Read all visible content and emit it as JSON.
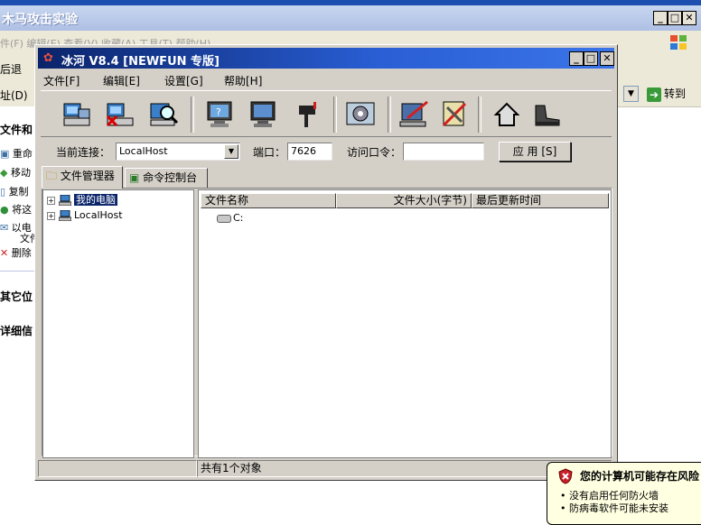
{
  "bg_window": {
    "title": "木马攻击实验",
    "menu_text": "件(F)  编辑(E)  查看(V)  收藏(A)  工具(T)  帮助(H)",
    "back_label": "后退",
    "addr_label": "址(D)",
    "go_label": "转到",
    "tasks": {
      "file_tasks_head": "文件和",
      "items": [
        "重命",
        "移动",
        "复制",
        "将这",
        "以电",
        "文件",
        "删除"
      ],
      "other_places_head": "其它位",
      "details_head": "详细信"
    }
  },
  "window": {
    "title": "冰河 V8.4 [NEWFUN 专版]",
    "menus": [
      "文件[F]",
      "编辑[E]",
      "设置[G]",
      "帮助[H]"
    ],
    "toolbar_icons": [
      "add-host-icon",
      "delete-host-icon",
      "search-host-icon",
      "screen-capture-icon",
      "screen-control-icon",
      "send-file-icon",
      "system-settings-icon",
      "edit-icon",
      "tools-icon",
      "home-icon",
      "exit-icon"
    ]
  },
  "connection": {
    "current_label": "当前连接：",
    "current_value": "LocalHost",
    "port_label": "端口：",
    "port_value": "7626",
    "password_label": "访问口令：",
    "password_value": "",
    "apply_label": "应 用 [S]"
  },
  "tabs": [
    "文件管理器",
    "命令控制台"
  ],
  "tree": [
    {
      "label": "我的电脑",
      "selected": true
    },
    {
      "label": "LocalHost",
      "selected": false
    }
  ],
  "list": {
    "columns": [
      "文件名称",
      "文件大小(字节)",
      "最后更新时间"
    ],
    "rows": [
      {
        "name": "C:"
      }
    ]
  },
  "status": {
    "left": "",
    "middle": "共有1个对象"
  },
  "balloon": {
    "title": "您的计算机可能存在风险",
    "lines": [
      "• 没有启用任何防火墙",
      "• 防病毒软件可能未安装"
    ]
  },
  "colors": {
    "titlebar": "#0a246a",
    "face": "#d4d0c8",
    "selection": "#0a246a",
    "balloon_bg": "#ffffe1"
  }
}
